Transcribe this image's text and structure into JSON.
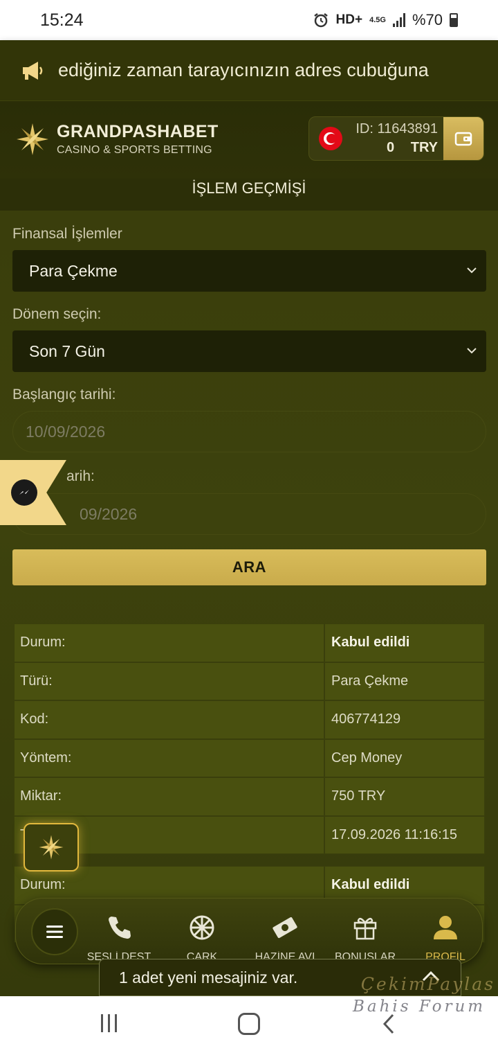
{
  "status_bar": {
    "time": "15:24",
    "network": "HD+",
    "network_type": "4.5G",
    "battery": "%70"
  },
  "announcement": {
    "text": "ediğiniz zaman tarayıcınızın adres cubuğuna",
    "icon": "megaphone-icon"
  },
  "header": {
    "brand_name": "GRANDPASHABET",
    "brand_tagline": "CASINO & SPORTS BETTING",
    "account_id": "ID: 11643891",
    "balance_amount": "0",
    "balance_currency": "TRY",
    "flag": "turkey-flag-icon",
    "wallet_icon": "wallet-icon"
  },
  "page": {
    "title": "İŞLEM GEÇMİŞİ"
  },
  "filters": {
    "financial_label": "Finansal İşlemler",
    "financial_value": "Para Çekme",
    "period_label": "Dönem seçin:",
    "period_value": "Son 7 Gün",
    "start_label": "Başlangıç tarihi:",
    "start_value": "10/09/2026",
    "end_label_partial": "arih:",
    "end_value_partial": "09/2026",
    "search_label": "ARA"
  },
  "transactions": [
    {
      "rows": [
        {
          "label": "Durum:",
          "value": "Kabul edildi",
          "bold": true
        },
        {
          "label": "Türü:",
          "value": "Para Çekme"
        },
        {
          "label": "Kod:",
          "value": "406774129"
        },
        {
          "label": "Yöntem:",
          "value": "Cep Money"
        },
        {
          "label": "Miktar:",
          "value": "750 TRY"
        },
        {
          "label": "T",
          "value": "17.09.2026 11:16:15"
        }
      ]
    },
    {
      "rows": [
        {
          "label": "Durum:",
          "value": "Kabul edildi",
          "bold": true
        }
      ]
    }
  ],
  "bottom_nav": {
    "items": [
      {
        "label": "SESLİ DEST",
        "icon": "phone-icon"
      },
      {
        "label": "ÇARK",
        "icon": "wheel-icon"
      },
      {
        "label": "HAZİNE AVI",
        "icon": "money-icon"
      },
      {
        "label": "BONUSLAR",
        "icon": "gift-icon"
      },
      {
        "label": "PROFİL",
        "icon": "user-icon",
        "active": true
      }
    ]
  },
  "toast": {
    "text": "1 adet yeni mesajiniz var."
  },
  "watermark": {
    "line1": "ÇekimPaylas",
    "line2": "Bahis Forum"
  },
  "colors": {
    "background": "#2c3008",
    "gold": "#d8bc5a",
    "table_cell": "#49500f",
    "active_nav": "#d9b94b"
  }
}
